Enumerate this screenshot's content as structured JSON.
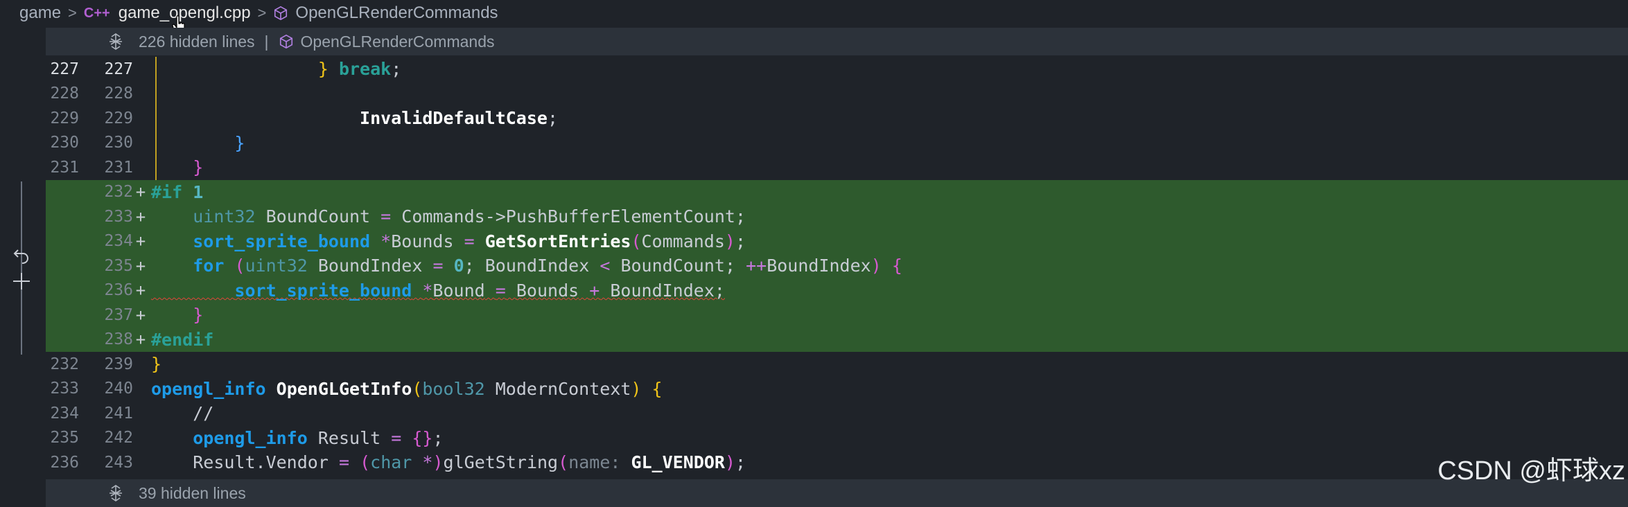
{
  "breadcrumb": {
    "root": "game",
    "file_icon": "C++",
    "file": "game_opengl.cpp",
    "symbol": "OpenGLRenderCommands"
  },
  "hidden_top": {
    "label": "226 hidden lines",
    "separator": "|",
    "symbol": "OpenGLRenderCommands"
  },
  "hidden_bottom": {
    "label": "39 hidden lines"
  },
  "lines": [
    {
      "old": "227",
      "new": "227",
      "marker": ""
    },
    {
      "old": "228",
      "new": "228",
      "marker": ""
    },
    {
      "old": "229",
      "new": "229",
      "marker": ""
    },
    {
      "old": "230",
      "new": "230",
      "marker": ""
    },
    {
      "old": "231",
      "new": "231",
      "marker": ""
    },
    {
      "old": "",
      "new": "232",
      "marker": "+"
    },
    {
      "old": "",
      "new": "233",
      "marker": "+"
    },
    {
      "old": "",
      "new": "234",
      "marker": "+"
    },
    {
      "old": "",
      "new": "235",
      "marker": "+"
    },
    {
      "old": "",
      "new": "236",
      "marker": "+"
    },
    {
      "old": "",
      "new": "237",
      "marker": "+"
    },
    {
      "old": "",
      "new": "238",
      "marker": "+"
    },
    {
      "old": "232",
      "new": "239",
      "marker": ""
    },
    {
      "old": "233",
      "new": "240",
      "marker": ""
    },
    {
      "old": "234",
      "new": "241",
      "marker": ""
    },
    {
      "old": "235",
      "new": "242",
      "marker": ""
    },
    {
      "old": "236",
      "new": "243",
      "marker": ""
    }
  ],
  "code": {
    "l227": {
      "brace": "}",
      "kw": "break",
      "semi": ";"
    },
    "l229": {
      "fn": "InvalidDefaultCase",
      "semi": ";"
    },
    "l230": {
      "brace": "}"
    },
    "l231": {
      "brace": "}"
    },
    "l232": {
      "pre": "#if",
      "num": "1"
    },
    "l233": {
      "type": "uint32",
      "var": "BoundCount",
      "op": "=",
      "rhs": "Commands->PushBufferElementCount;"
    },
    "l234": {
      "type": "sort_sprite_bound",
      "ptr": "*",
      "var": "Bounds",
      "op": "=",
      "fn": "GetSortEntries",
      "open": "(",
      "arg": "Commands",
      "close": ")",
      "semi": ";"
    },
    "l235": {
      "kw": "for",
      "open": "(",
      "type": "uint32",
      "var": "BoundIndex",
      "op1": "=",
      "num": "0",
      "mid1": "; BoundIndex",
      "op2": "<",
      "mid2": "BoundCount;",
      "op3": "++",
      "var2": "BoundIndex",
      "close": ")",
      "brace": "{"
    },
    "l236": {
      "type": "sort_sprite_bound",
      "ptr": "*",
      "var": "Bound",
      "op": "=",
      "mid": "Bounds",
      "op2": "+",
      "rest": "BoundIndex;"
    },
    "l237": {
      "brace": "}"
    },
    "l238": {
      "pre": "#endif"
    },
    "l239": {
      "brace": "}"
    },
    "l240": {
      "type": "opengl_info",
      "fn": "OpenGLGetInfo",
      "open": "(",
      "ptype": "bool32",
      "param": "ModernContext",
      "close": ")",
      "brace": "{"
    },
    "l241": {
      "comment": "//"
    },
    "l242": {
      "type": "opengl_info",
      "var": "Result",
      "op": "=",
      "braces": "{}",
      "semi": ";"
    },
    "l243": {
      "lhs": "Result.Vendor",
      "op": "=",
      "open": "(",
      "ctype": "char",
      "star": "*",
      "close": ")",
      "fn": "glGetString",
      "popen": "(",
      "hint": "name:",
      "arg": "GL_VENDOR",
      "pclose": ")",
      "semi": ";"
    }
  },
  "watermark": "CSDN @虾球xz",
  "colors": {
    "added_bg": "#2e5a2d",
    "keyword": "#2aa198",
    "type": "#1e9be8",
    "bracket_yellow": "#f0c419",
    "bracket_blue": "#4aa3ff",
    "bracket_magenta": "#d65ad0"
  }
}
